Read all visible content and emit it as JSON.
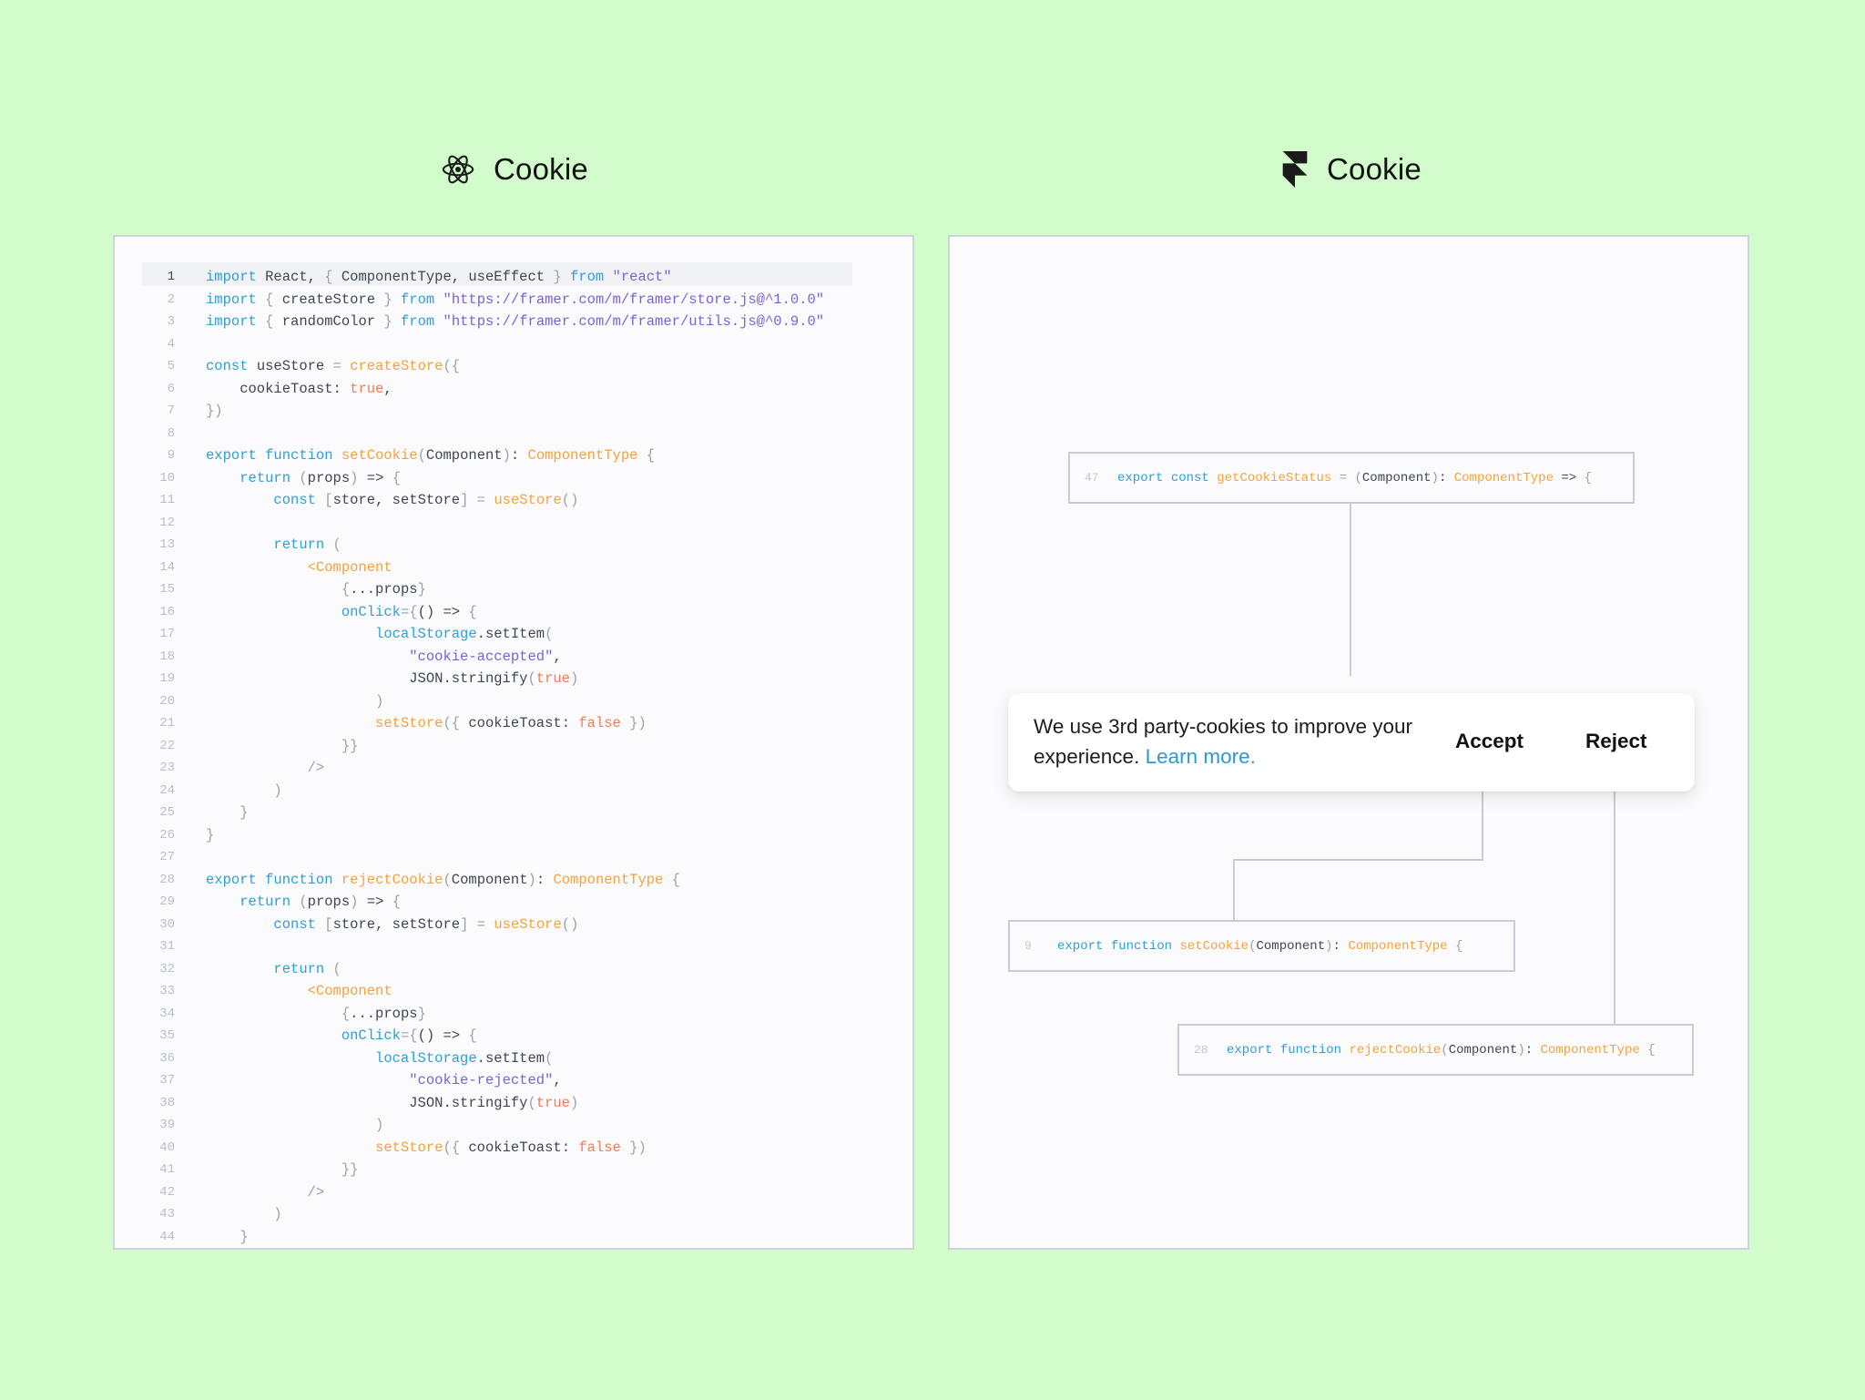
{
  "left_heading": {
    "title": "Cookie",
    "icon": "react-icon"
  },
  "right_heading": {
    "title": "Cookie",
    "icon": "framer-icon"
  },
  "colors": {
    "background": "#d2fccb",
    "keyword": "#2f9fd0",
    "function": "#f2a33c",
    "string": "#7b62d0",
    "boolean": "#ee7c54",
    "link": "#2e98d2"
  },
  "code": {
    "lines": [
      [
        [
          "kw",
          "import"
        ],
        [
          "tx",
          " React, "
        ],
        [
          "p",
          "{"
        ],
        [
          "tx",
          " ComponentType, useEffect "
        ],
        [
          "p",
          "}"
        ],
        [
          "tx",
          " "
        ],
        [
          "kw",
          "from"
        ],
        [
          "tx",
          " "
        ],
        [
          "str",
          "\"react\""
        ]
      ],
      [
        [
          "kw",
          "import"
        ],
        [
          "tx",
          " "
        ],
        [
          "p",
          "{"
        ],
        [
          "tx",
          " createStore "
        ],
        [
          "p",
          "}"
        ],
        [
          "tx",
          " "
        ],
        [
          "kw",
          "from"
        ],
        [
          "tx",
          " "
        ],
        [
          "str",
          "\"https://framer.com/m/framer/store.js@^1.0.0\""
        ]
      ],
      [
        [
          "kw",
          "import"
        ],
        [
          "tx",
          " "
        ],
        [
          "p",
          "{"
        ],
        [
          "tx",
          " randomColor "
        ],
        [
          "p",
          "}"
        ],
        [
          "tx",
          " "
        ],
        [
          "kw",
          "from"
        ],
        [
          "tx",
          " "
        ],
        [
          "str",
          "\"https://framer.com/m/framer/utils.js@^0.9.0\""
        ]
      ],
      [],
      [
        [
          "kw",
          "const"
        ],
        [
          "tx",
          " useStore "
        ],
        [
          "p",
          "="
        ],
        [
          "tx",
          " "
        ],
        [
          "fn",
          "createStore"
        ],
        [
          "p",
          "({"
        ]
      ],
      [
        [
          "tx",
          "    cookieToast: "
        ],
        [
          "bool",
          "true"
        ],
        [
          "tx",
          ","
        ]
      ],
      [
        [
          "p",
          "})"
        ]
      ],
      [],
      [
        [
          "kw",
          "export"
        ],
        [
          "tx",
          " "
        ],
        [
          "kw",
          "function"
        ],
        [
          "tx",
          " "
        ],
        [
          "fn",
          "setCookie"
        ],
        [
          "p",
          "("
        ],
        [
          "tx",
          "Component"
        ],
        [
          "p",
          ")"
        ],
        [
          "tx",
          ": "
        ],
        [
          "fn",
          "ComponentType"
        ],
        [
          "tx",
          " "
        ],
        [
          "p",
          "{"
        ]
      ],
      [
        [
          "tx",
          "    "
        ],
        [
          "kw",
          "return"
        ],
        [
          "tx",
          " "
        ],
        [
          "p",
          "("
        ],
        [
          "tx",
          "props"
        ],
        [
          "p",
          ")"
        ],
        [
          "tx",
          " => "
        ],
        [
          "p",
          "{"
        ]
      ],
      [
        [
          "tx",
          "        "
        ],
        [
          "kw",
          "const"
        ],
        [
          "tx",
          " "
        ],
        [
          "p",
          "["
        ],
        [
          "tx",
          "store, setStore"
        ],
        [
          "p",
          "]"
        ],
        [
          "tx",
          " "
        ],
        [
          "p",
          "="
        ],
        [
          "tx",
          " "
        ],
        [
          "fn",
          "useStore"
        ],
        [
          "p",
          "()"
        ]
      ],
      [],
      [
        [
          "tx",
          "        "
        ],
        [
          "kw",
          "return"
        ],
        [
          "tx",
          " "
        ],
        [
          "p",
          "("
        ]
      ],
      [
        [
          "tx",
          "            "
        ],
        [
          "fn",
          "<Component"
        ]
      ],
      [
        [
          "tx",
          "                "
        ],
        [
          "p",
          "{"
        ],
        [
          "tx",
          "...props"
        ],
        [
          "p",
          "}"
        ]
      ],
      [
        [
          "tx",
          "                "
        ],
        [
          "kw",
          "onClick"
        ],
        [
          "p",
          "={"
        ],
        [
          "tx",
          "() => "
        ],
        [
          "p",
          "{"
        ]
      ],
      [
        [
          "tx",
          "                    "
        ],
        [
          "kw",
          "localStorage"
        ],
        [
          "tx",
          ".setItem"
        ],
        [
          "p",
          "("
        ]
      ],
      [
        [
          "tx",
          "                        "
        ],
        [
          "str",
          "\"cookie-accepted\""
        ],
        [
          "tx",
          ","
        ]
      ],
      [
        [
          "tx",
          "                        JSON.stringify"
        ],
        [
          "p",
          "("
        ],
        [
          "bool",
          "true"
        ],
        [
          "p",
          ")"
        ]
      ],
      [
        [
          "tx",
          "                    "
        ],
        [
          "p",
          ")"
        ]
      ],
      [
        [
          "tx",
          "                    "
        ],
        [
          "fn",
          "setStore"
        ],
        [
          "p",
          "("
        ],
        [
          "p",
          "{"
        ],
        [
          "tx",
          " cookieToast: "
        ],
        [
          "bool",
          "false"
        ],
        [
          "tx",
          " "
        ],
        [
          "p",
          "})"
        ]
      ],
      [
        [
          "tx",
          "                "
        ],
        [
          "p",
          "}}"
        ]
      ],
      [
        [
          "tx",
          "            "
        ],
        [
          "p",
          "/>"
        ]
      ],
      [
        [
          "tx",
          "        "
        ],
        [
          "p",
          ")"
        ]
      ],
      [
        [
          "tx",
          "    "
        ],
        [
          "p",
          "}"
        ]
      ],
      [
        [
          "p",
          "}"
        ]
      ],
      [],
      [
        [
          "kw",
          "export"
        ],
        [
          "tx",
          " "
        ],
        [
          "kw",
          "function"
        ],
        [
          "tx",
          " "
        ],
        [
          "fn",
          "rejectCookie"
        ],
        [
          "p",
          "("
        ],
        [
          "tx",
          "Component"
        ],
        [
          "p",
          ")"
        ],
        [
          "tx",
          ": "
        ],
        [
          "fn",
          "ComponentType"
        ],
        [
          "tx",
          " "
        ],
        [
          "p",
          "{"
        ]
      ],
      [
        [
          "tx",
          "    "
        ],
        [
          "kw",
          "return"
        ],
        [
          "tx",
          " "
        ],
        [
          "p",
          "("
        ],
        [
          "tx",
          "props"
        ],
        [
          "p",
          ")"
        ],
        [
          "tx",
          " => "
        ],
        [
          "p",
          "{"
        ]
      ],
      [
        [
          "tx",
          "        "
        ],
        [
          "kw",
          "const"
        ],
        [
          "tx",
          " "
        ],
        [
          "p",
          "["
        ],
        [
          "tx",
          "store, setStore"
        ],
        [
          "p",
          "]"
        ],
        [
          "tx",
          " "
        ],
        [
          "p",
          "="
        ],
        [
          "tx",
          " "
        ],
        [
          "fn",
          "useStore"
        ],
        [
          "p",
          "()"
        ]
      ],
      [],
      [
        [
          "tx",
          "        "
        ],
        [
          "kw",
          "return"
        ],
        [
          "tx",
          " "
        ],
        [
          "p",
          "("
        ]
      ],
      [
        [
          "tx",
          "            "
        ],
        [
          "fn",
          "<Component"
        ]
      ],
      [
        [
          "tx",
          "                "
        ],
        [
          "p",
          "{"
        ],
        [
          "tx",
          "...props"
        ],
        [
          "p",
          "}"
        ]
      ],
      [
        [
          "tx",
          "                "
        ],
        [
          "kw",
          "onClick"
        ],
        [
          "p",
          "={"
        ],
        [
          "tx",
          "() => "
        ],
        [
          "p",
          "{"
        ]
      ],
      [
        [
          "tx",
          "                    "
        ],
        [
          "kw",
          "localStorage"
        ],
        [
          "tx",
          ".setItem"
        ],
        [
          "p",
          "("
        ]
      ],
      [
        [
          "tx",
          "                        "
        ],
        [
          "str",
          "\"cookie-rejected\""
        ],
        [
          "tx",
          ","
        ]
      ],
      [
        [
          "tx",
          "                        JSON.stringify"
        ],
        [
          "p",
          "("
        ],
        [
          "bool",
          "true"
        ],
        [
          "p",
          ")"
        ]
      ],
      [
        [
          "tx",
          "                    "
        ],
        [
          "p",
          ")"
        ]
      ],
      [
        [
          "tx",
          "                    "
        ],
        [
          "fn",
          "setStore"
        ],
        [
          "p",
          "("
        ],
        [
          "p",
          "{"
        ],
        [
          "tx",
          " cookieToast: "
        ],
        [
          "bool",
          "false"
        ],
        [
          "tx",
          " "
        ],
        [
          "p",
          "})"
        ]
      ],
      [
        [
          "tx",
          "                "
        ],
        [
          "p",
          "}}"
        ]
      ],
      [
        [
          "tx",
          "            "
        ],
        [
          "p",
          "/>"
        ]
      ],
      [
        [
          "tx",
          "        "
        ],
        [
          "p",
          ")"
        ]
      ],
      [
        [
          "tx",
          "    "
        ],
        [
          "p",
          "}"
        ]
      ]
    ]
  },
  "snippets": {
    "status": {
      "line": "47",
      "tokens": [
        [
          "kw",
          "export"
        ],
        [
          "tx",
          " "
        ],
        [
          "kw",
          "const"
        ],
        [
          "tx",
          " "
        ],
        [
          "fn",
          "getCookieStatus"
        ],
        [
          "tx",
          " "
        ],
        [
          "p",
          "="
        ],
        [
          "tx",
          " "
        ],
        [
          "p",
          "("
        ],
        [
          "tx",
          "Component"
        ],
        [
          "p",
          ")"
        ],
        [
          "tx",
          ": "
        ],
        [
          "fn",
          "ComponentType"
        ],
        [
          "tx",
          " => "
        ],
        [
          "p",
          "{"
        ]
      ]
    },
    "set": {
      "line": "9",
      "tokens": [
        [
          "kw",
          "export"
        ],
        [
          "tx",
          " "
        ],
        [
          "kw",
          "function"
        ],
        [
          "tx",
          " "
        ],
        [
          "fn",
          "setCookie"
        ],
        [
          "p",
          "("
        ],
        [
          "tx",
          "Component"
        ],
        [
          "p",
          ")"
        ],
        [
          "tx",
          ": "
        ],
        [
          "fn",
          "ComponentType"
        ],
        [
          "tx",
          " "
        ],
        [
          "p",
          "{"
        ]
      ]
    },
    "reject": {
      "line": "28",
      "tokens": [
        [
          "kw",
          "export"
        ],
        [
          "tx",
          " "
        ],
        [
          "kw",
          "function"
        ],
        [
          "tx",
          " "
        ],
        [
          "fn",
          "rejectCookie"
        ],
        [
          "p",
          "("
        ],
        [
          "tx",
          "Component"
        ],
        [
          "p",
          ")"
        ],
        [
          "tx",
          ": "
        ],
        [
          "fn",
          "ComponentType"
        ],
        [
          "tx",
          " "
        ],
        [
          "p",
          "{"
        ]
      ]
    }
  },
  "toast": {
    "message": "We use 3rd party-cookies to improve your experience.",
    "link_label": "Learn more.",
    "accept_label": "Accept",
    "reject_label": "Reject"
  }
}
